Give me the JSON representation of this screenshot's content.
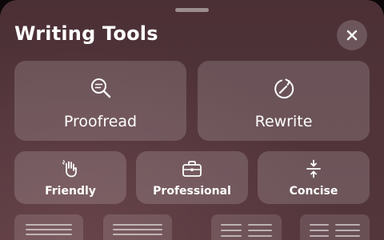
{
  "panel": {
    "title": "Writing Tools",
    "close_icon": "close-icon"
  },
  "tools": {
    "primary": [
      {
        "label": "Proofread",
        "icon": "magnifier-text-icon"
      },
      {
        "label": "Rewrite",
        "icon": "rewrite-circular-arrow-icon"
      }
    ],
    "secondary": [
      {
        "label": "Friendly",
        "icon": "waving-hand-icon"
      },
      {
        "label": "Professional",
        "icon": "briefcase-icon"
      },
      {
        "label": "Concise",
        "icon": "compress-icon"
      }
    ]
  },
  "colors": {
    "background": "#4f3339",
    "tile": "rgba(255,255,255,0.16)",
    "text": "#ffffff"
  }
}
